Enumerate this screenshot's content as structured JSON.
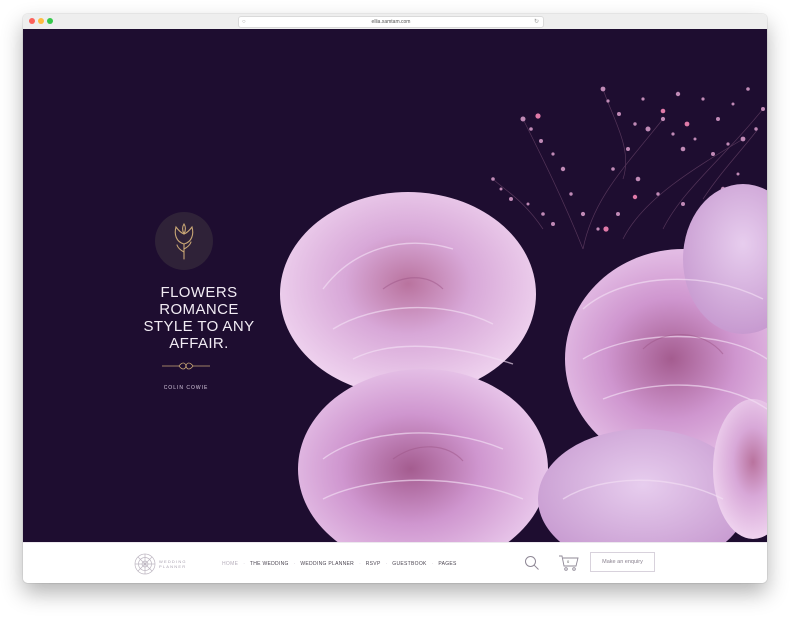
{
  "browser": {
    "url": "ellia.xamtam.com"
  },
  "hero": {
    "tagline_lines": [
      "FLOWERS",
      "ROMANCE",
      "STYLE TO ANY",
      "AFFAIR."
    ],
    "author": "COLIN COWIE"
  },
  "brand": {
    "line1": "WEDDING",
    "line2": "PLANNER"
  },
  "menu": {
    "items": [
      "HOME",
      "THE WEDDING",
      "WEDDING PLANNER",
      "RSVP",
      "GUESTBOOK",
      "PAGES"
    ]
  },
  "cart": {
    "count": "0"
  },
  "cta": {
    "label": "Make an enquiry"
  },
  "icons": {
    "logo": "tulip-icon",
    "search": "search-icon",
    "cart": "cart-icon",
    "lock": "lock-icon",
    "reload": "reload-icon"
  },
  "colors": {
    "hero_bg": "#1e0d30",
    "accent_gold": "#c9a775",
    "peony_pink": "#d7a8d7",
    "nav_bg": "#ffffff"
  }
}
